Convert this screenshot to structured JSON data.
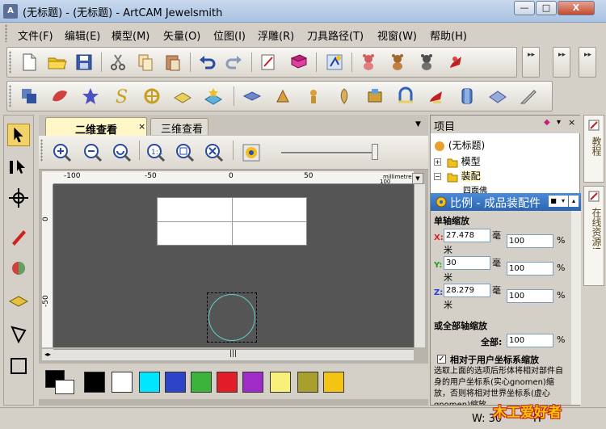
{
  "window": {
    "app_icon": "A",
    "title": "(无标题) - (无标题) - ArtCAM Jewelsmith",
    "minimize": "—",
    "maximize": "□",
    "close": "X"
  },
  "menu": {
    "items": [
      "文件(F)",
      "编辑(E)",
      "模型(M)",
      "矢量(O)",
      "位图(I)",
      "浮雕(R)",
      "刀具路径(T)",
      "视窗(W)",
      "帮助(H)"
    ]
  },
  "toolbar1": {
    "icons": [
      "new-file-icon",
      "open-folder-icon",
      "save-icon",
      "cut-icon",
      "copy-icon",
      "paste-icon",
      "undo-icon",
      "redo-icon",
      "notes-icon",
      "book-icon",
      "wizard-icon",
      "teddy-bear-icon",
      "teddy-bear-brown-icon",
      "teddy-bear-dark-icon",
      "figure-red-icon"
    ]
  },
  "toolbar2": {
    "icons": [
      "vector-shapes-icon",
      "petal-icon",
      "star-icon",
      "letter-s-icon",
      "celtic-knot-icon",
      "layer-icon",
      "layer-star-icon",
      "diamond-flat-icon",
      "bail-icon",
      "clasp-icon",
      "earring-icon",
      "gem-setting-icon",
      "ring-arc-icon",
      "figure-red-small-icon",
      "band-icon",
      "plane-icon",
      "knife-icon"
    ]
  },
  "view_tabs": {
    "tab_2d": "二维查看",
    "tab_2d_close": "×",
    "tab_3d": "三维查看",
    "dropdown": "▼"
  },
  "ruler": {
    "ticks_x": [
      "-100",
      "-50",
      "0",
      "50",
      "100"
    ],
    "ticks_y": [
      "0",
      "-50"
    ],
    "units": "millimetres"
  },
  "scrollbar": {
    "thumb": "|||",
    "down_arrow": "▼"
  },
  "palette": {
    "colors": [
      "#000000",
      "#ffffff",
      "#00e6ff",
      "#2c45c8",
      "#3cb43c",
      "#e11e28",
      "#a02cc8",
      "#f8f07a",
      "#a8a02c",
      "#f4c414"
    ]
  },
  "project_panel": {
    "title": "项目",
    "tree": [
      {
        "label": "(无标题)",
        "toggle": ""
      },
      {
        "label": "模型",
        "toggle": "+"
      },
      {
        "label": "装配",
        "toggle": "−"
      },
      {
        "label": "四面佛",
        "toggle": ""
      }
    ]
  },
  "scale_panel": {
    "title": "比例 - 成品装配件",
    "single_axis_header": "单轴缩放",
    "x_label": "X:",
    "x_value": "27.478",
    "y_label": "Y:",
    "y_value": "30",
    "z_label": "Z:",
    "z_value": "28.279",
    "unit_hao": "毫",
    "unit_mi": "米",
    "x_percent": "100",
    "y_percent": "100",
    "z_percent": "100",
    "percent_sign": "%",
    "all_axis_header": "或全部轴缩放",
    "all_label": "全部:",
    "all_value": "100",
    "relative_checkbox_label": "相对于用户坐标系缩放",
    "description": "选取上面的选项后形体将相对部件自身的用户坐标系(实心gnomen)缩放，否则将相对世界坐标系(虚心gnomen)缩放"
  },
  "side_tabs": {
    "tutorial": "教程",
    "online_resources": "在线资源!"
  },
  "status": {
    "width_text": "W: 30",
    "h_text": "H"
  },
  "watermark": {
    "text": "木工爱好者"
  }
}
